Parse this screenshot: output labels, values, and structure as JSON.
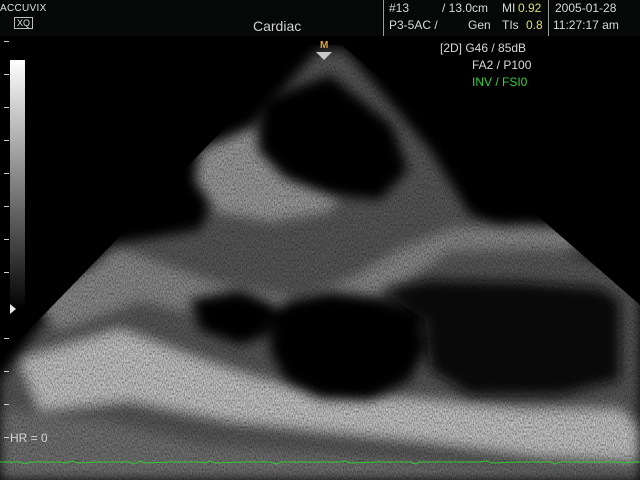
{
  "header": {
    "brand": "ACCUVIX",
    "model": "XQ",
    "preset": "Cardiac",
    "frame": "#13",
    "depth": "/ 13.0cm",
    "mi_label": "MI",
    "mi_value": "0.92",
    "probe": "P3-5AC /",
    "gen_label": "Gen",
    "tis_label": "TIs",
    "tis_value": "0.8",
    "date": "2005-01-28",
    "time": "11:27:17 am"
  },
  "params": {
    "line1": "[2D] G46 / 85dB",
    "line2": "FA2 / P100",
    "line3": "INV / FSI0"
  },
  "focus_marker": "M",
  "hr": "HR = 0",
  "icons": {
    "depth_marker": "triangle-right-icon"
  },
  "colors": {
    "ecg": "#33cc33",
    "focus": "#e1a436",
    "param_highlight": "#33d13b"
  }
}
